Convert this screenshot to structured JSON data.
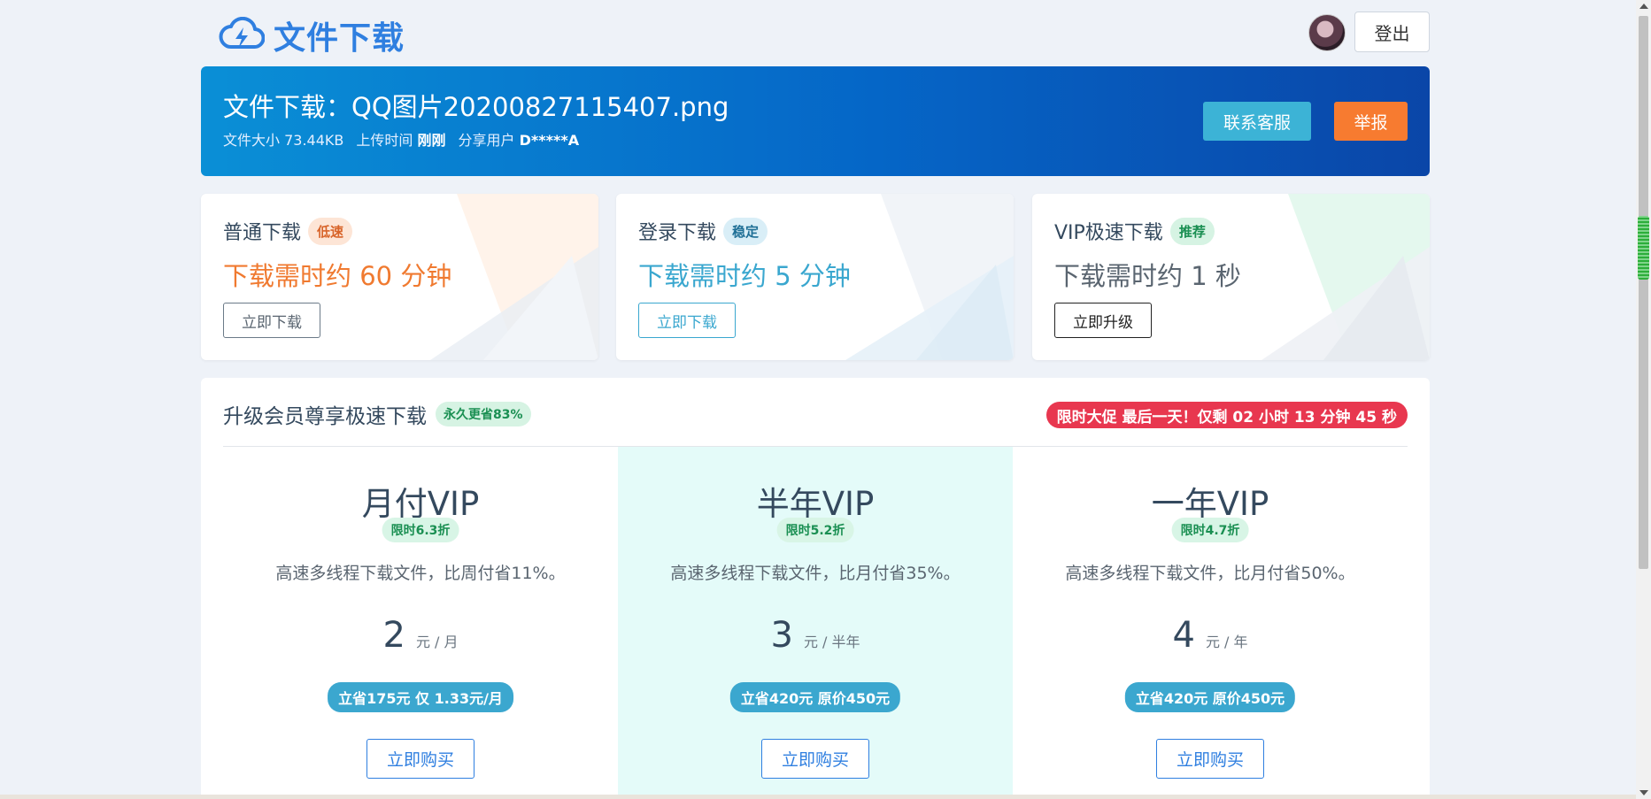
{
  "brand": {
    "name": "文件下载"
  },
  "header": {
    "logout_label": "登出"
  },
  "file": {
    "title": "文件下载：QQ图片20200827115407.png",
    "size_label": "文件大小",
    "size_value": "73.44KB",
    "upload_label": "上传时间",
    "upload_value": "刚刚",
    "user_label": "分享用户",
    "user_value": "D*****A",
    "contact_label": "联系客服",
    "report_label": "举报"
  },
  "cards": [
    {
      "title": "普通下载",
      "badge": "低速",
      "time": "下载需时约 60 分钟",
      "button": "立即下载"
    },
    {
      "title": "登录下载",
      "badge": "稳定",
      "time": "下载需时约 5 分钟",
      "button": "立即下载"
    },
    {
      "title": "VIP极速下载",
      "badge": "推荐",
      "time": "下载需时约 1 秒",
      "button": "立即升级"
    }
  ],
  "vip": {
    "title": "升级会员尊享极速下载",
    "badge": "永久更省83%",
    "promo": "限时大促 最后一天！仅剩 02 小时 13 分钟 45 秒",
    "plans": [
      {
        "name": "月付VIP",
        "discount": "限时6.3折",
        "desc": "高速多线程下载文件，比周付省11%。",
        "price": "2",
        "unit": "元 / 月",
        "save": "立省175元 仅 1.33元/月",
        "buy": "立即购买"
      },
      {
        "name": "半年VIP",
        "discount": "限时5.2折",
        "desc": "高速多线程下载文件，比月付省35%。",
        "price": "3",
        "unit": "元 / 半年",
        "save": "立省420元 原价450元",
        "buy": "立即购买"
      },
      {
        "name": "一年VIP",
        "discount": "限时4.7折",
        "desc": "高速多线程下载文件，比月付省50%。",
        "price": "4",
        "unit": "元 / 年",
        "save": "立省420元 原价450元",
        "buy": "立即购买"
      }
    ]
  },
  "colors": {
    "brand_blue": "#2f7fe0",
    "slow": "#f07a30",
    "stable": "#3aa7cf",
    "vip": "#5a6570",
    "promo_red": "#e8374f"
  }
}
